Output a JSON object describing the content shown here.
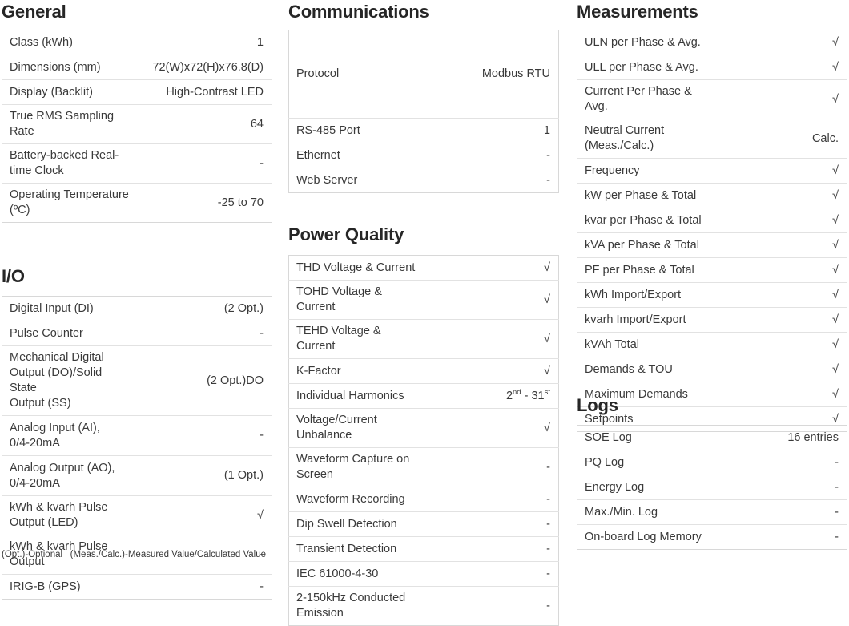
{
  "footnote": "(Opt.)-Optional   (Meas./Calc.)-Measured Value/Calculated Value",
  "sections": {
    "general": {
      "title": "General",
      "rows": [
        {
          "label": "Class (kWh)",
          "value": "1"
        },
        {
          "label": "Dimensions (mm)",
          "value": "72(W)x72(H)x76.8(D)"
        },
        {
          "label": "Display (Backlit)",
          "value": "High-Contrast LED"
        },
        {
          "label": "True RMS Sampling Rate",
          "value": "64"
        },
        {
          "label": "Battery-backed Real-time Clock",
          "value": "-"
        },
        {
          "label": "Operating Temperature (ºC)",
          "value": "-25 to 70"
        }
      ]
    },
    "io": {
      "title": "I/O",
      "rows": [
        {
          "label": "Digital Input (DI)",
          "value": "(2 Opt.)"
        },
        {
          "label": "Pulse Counter",
          "value": "-"
        },
        {
          "label": "Mechanical Digital\nOutput (DO)/Solid State\nOutput (SS)",
          "value": "(2 Opt.)DO"
        },
        {
          "label": "Analog Input (AI),\n0/4-20mA",
          "value": "-"
        },
        {
          "label": "Analog Output (AO),\n0/4-20mA",
          "value": "(1 Opt.)"
        },
        {
          "label": "kWh & kvarh Pulse Output (LED)",
          "value": "√"
        },
        {
          "label": "kWh & kvarh Pulse Output",
          "value": "-"
        },
        {
          "label": "IRIG-B (GPS)",
          "value": "-"
        }
      ]
    },
    "communications": {
      "title": "Communications",
      "rows": [
        {
          "label": "Protocol",
          "value": "Modbus  RTU"
        },
        {
          "label": "RS-485 Port",
          "value": "1"
        },
        {
          "label": "Ethernet",
          "value": "-"
        },
        {
          "label": "Web Server",
          "value": "-"
        }
      ]
    },
    "power_quality": {
      "title": "Power Quality",
      "rows": [
        {
          "label": "THD Voltage & Current",
          "value": "√"
        },
        {
          "label": "TOHD Voltage & Current",
          "value": "√"
        },
        {
          "label": "TEHD Voltage & Current",
          "value": "√"
        },
        {
          "label": "K-Factor",
          "value": "√"
        },
        {
          "label": "Individual Harmonics",
          "value": "2nd - 31st",
          "value_html": "2<sup>nd</sup> - 31<sup>st</sup>"
        },
        {
          "label": "Voltage/Current Unbalance",
          "value": "√"
        },
        {
          "label": "Waveform Capture on Screen",
          "value": "-"
        },
        {
          "label": "Waveform Recording",
          "value": "-"
        },
        {
          "label": "Dip Swell Detection",
          "value": "-"
        },
        {
          "label": "Transient Detection",
          "value": "-"
        },
        {
          "label": "IEC 61000-4-30",
          "value": "-"
        },
        {
          "label": "2-150kHz Conducted Emission",
          "value": "-"
        }
      ]
    },
    "measurements": {
      "title": "Measurements",
      "rows": [
        {
          "label": "ULN per Phase & Avg.",
          "value": "√"
        },
        {
          "label": "ULL per Phase & Avg.",
          "value": "√"
        },
        {
          "label": "Current Per Phase & Avg.",
          "value": "√"
        },
        {
          "label": "Neutral Current (Meas./Calc.)",
          "value": "Calc."
        },
        {
          "label": "Frequency",
          "value": "√"
        },
        {
          "label": "kW per Phase & Total",
          "value": "√"
        },
        {
          "label": "kvar per Phase & Total",
          "value": "√"
        },
        {
          "label": "kVA per Phase & Total",
          "value": "√"
        },
        {
          "label": "PF per Phase & Total",
          "value": "√"
        },
        {
          "label": "kWh Import/Export",
          "value": "√"
        },
        {
          "label": "kvarh Import/Export",
          "value": "√"
        },
        {
          "label": "kVAh Total",
          "value": "√"
        },
        {
          "label": "Demands & TOU",
          "value": "√"
        },
        {
          "label": "Maximum Demands",
          "value": "√"
        },
        {
          "label": "Setpoints",
          "value": "√"
        }
      ]
    },
    "logs": {
      "title": "Logs",
      "rows": [
        {
          "label": "SOE Log",
          "value": "16 entries"
        },
        {
          "label": "PQ Log",
          "value": "-"
        },
        {
          "label": "Energy Log",
          "value": "-"
        },
        {
          "label": "Max./Min. Log",
          "value": "-"
        },
        {
          "label": "On-board Log Memory",
          "value": "-"
        }
      ]
    }
  }
}
